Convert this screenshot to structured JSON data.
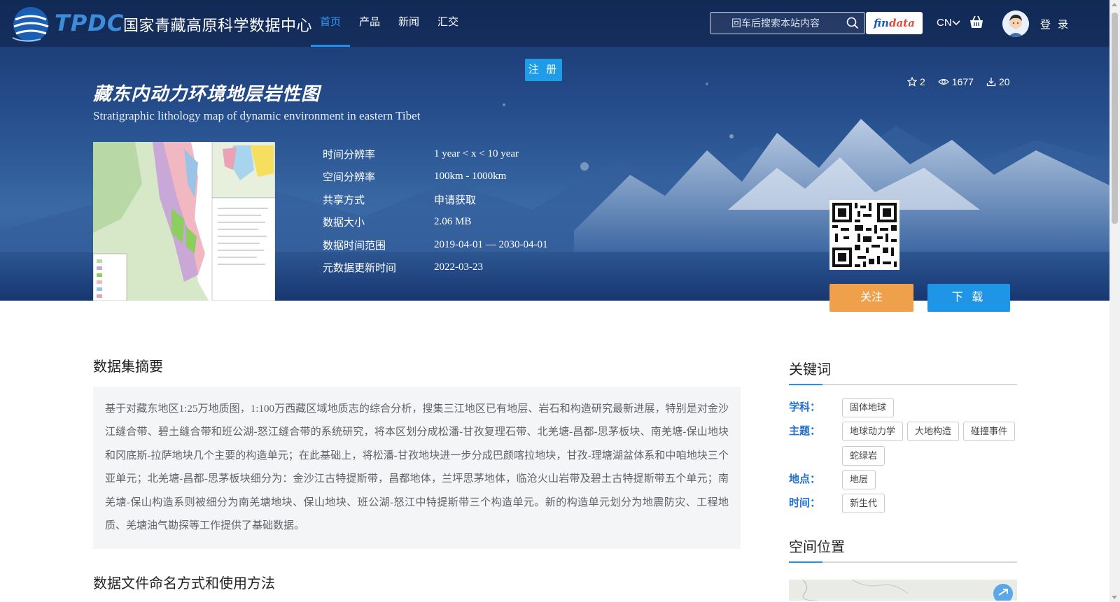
{
  "nav": {
    "logo_abbr": "TPDC",
    "logo_name": "国家青藏高原科学数据中心",
    "menu": [
      {
        "label": "首页",
        "active": true
      },
      {
        "label": "产品",
        "active": false
      },
      {
        "label": "新闻",
        "active": false
      },
      {
        "label": "汇交",
        "active": false
      }
    ],
    "search_placeholder": "回车后搜索本站内容",
    "findata_prefix": "fin",
    "findata_suffix": "data",
    "lang": "CN",
    "login": "登 录"
  },
  "register_label": "注 册",
  "dataset": {
    "title_cn": "藏东内动力环境地层岩性图",
    "title_en": "Stratigraphic lithology map of dynamic environment in eastern Tibet",
    "stats": {
      "favorites": "2",
      "views": "1677",
      "downloads": "20"
    },
    "meta": [
      {
        "label": "时间分辨率",
        "value": "1 year < x < 10 year"
      },
      {
        "label": "空间分辨率",
        "value": "100km - 1000km"
      },
      {
        "label": "共享方式",
        "value": "申请获取"
      },
      {
        "label": "数据大小",
        "value": "2.06 MB"
      },
      {
        "label": "数据时间范围",
        "value": "2019-04-01 — 2030-04-01"
      },
      {
        "label": "元数据更新时间",
        "value": "2022-03-23"
      }
    ],
    "follow_label": "关注",
    "download_label": "下 载"
  },
  "summary": {
    "heading": "数据集摘要",
    "text": "基于对藏东地区1:25万地质图，1:100万西藏区域地质志的综合分析，搜集三江地区已有地层、岩石和构造研究最新进展，特别是对金沙江缝合带、碧土缝合带和班公湖-怒江缝合带的系统研究，将本区划分成松潘-甘孜复理石带、北羌塘-昌都-思茅板块、南羌塘-保山地块和冈底斯-拉萨地块几个主要的构造单元；在此基础上，将松潘-甘孜地块进一步分成巴颜喀拉地块，甘孜-理塘湖盆体系和中咱地块三个亚单元；北羌塘-昌都-思茅板块细分为：金沙江古特提斯带，昌都地体，兰坪思茅地体，临沧火山岩带及碧土古特提斯带五个单元；南羌塘-保山构造系则被细分为南羌塘地块、保山地块、班公湖-怒江中特提斯带三个构造单元。新的构造单元划分为地震防灾、工程地质、羌塘油气勘探等工作提供了基础数据。"
  },
  "naming_heading": "数据文件命名方式和使用方法",
  "keywords": {
    "heading": "关键词",
    "groups": [
      {
        "label": "学科：",
        "tags": [
          "固体地球"
        ]
      },
      {
        "label": "主题：",
        "tags": [
          "地球动力学",
          "大地构造",
          "碰撞事件",
          "蛇绿岩"
        ]
      },
      {
        "label": "地点：",
        "tags": [
          "地层"
        ]
      },
      {
        "label": "时间：",
        "tags": [
          "新生代"
        ]
      }
    ]
  },
  "spatial_heading": "空间位置",
  "colors": {
    "accent": "#1f95e8",
    "follow": "#efa04a",
    "keyword_label": "#1f6fd1"
  }
}
